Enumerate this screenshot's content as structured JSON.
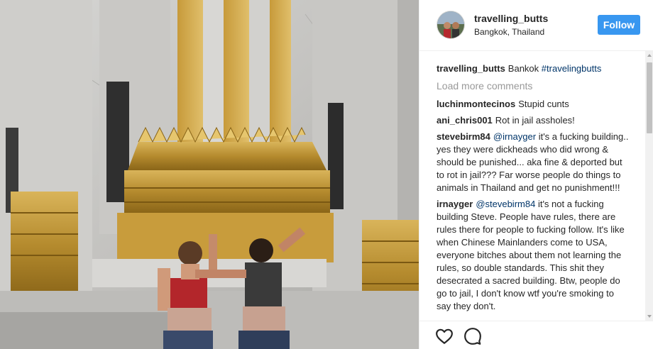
{
  "post": {
    "username": "travelling_butts",
    "location": "Bangkok, Thailand",
    "follow_label": "Follow"
  },
  "caption": {
    "username": "travelling_butts",
    "text": "Bankok",
    "hashtag": "#travelingbutts"
  },
  "load_more_label": "Load more comments",
  "comments": [
    {
      "username": "luchinmontecinos",
      "text": "Stupid cunts"
    },
    {
      "username": "ani_chris001",
      "text": "Rot in jail assholes!"
    },
    {
      "username": "stevebirm84",
      "mention": "@irnayger",
      "text": "it's a fucking building.. yes they were dickheads who did wrong & should be punished... aka fine & deported but to rot in jail??? Far worse people do things to animals in Thailand and get no punishment!!!"
    },
    {
      "username": "irnayger",
      "mention": "@stevebirm84",
      "text": "it's not a fucking building Steve. People have rules, there are rules there for people to fucking follow. It's like when Chinese Mainlanders come to USA, everyone bitches about them not learning the rules, so double standards. This shit they desecrated a sacred building. Btw, people do go to jail, I don't know wtf you're smoking to say they don't."
    }
  ],
  "icons": {
    "like": "heart-icon",
    "comment": "speech-bubble-icon"
  },
  "colors": {
    "follow_button": "#3897f0",
    "hashtag": "#003569",
    "muted": "#999999"
  }
}
